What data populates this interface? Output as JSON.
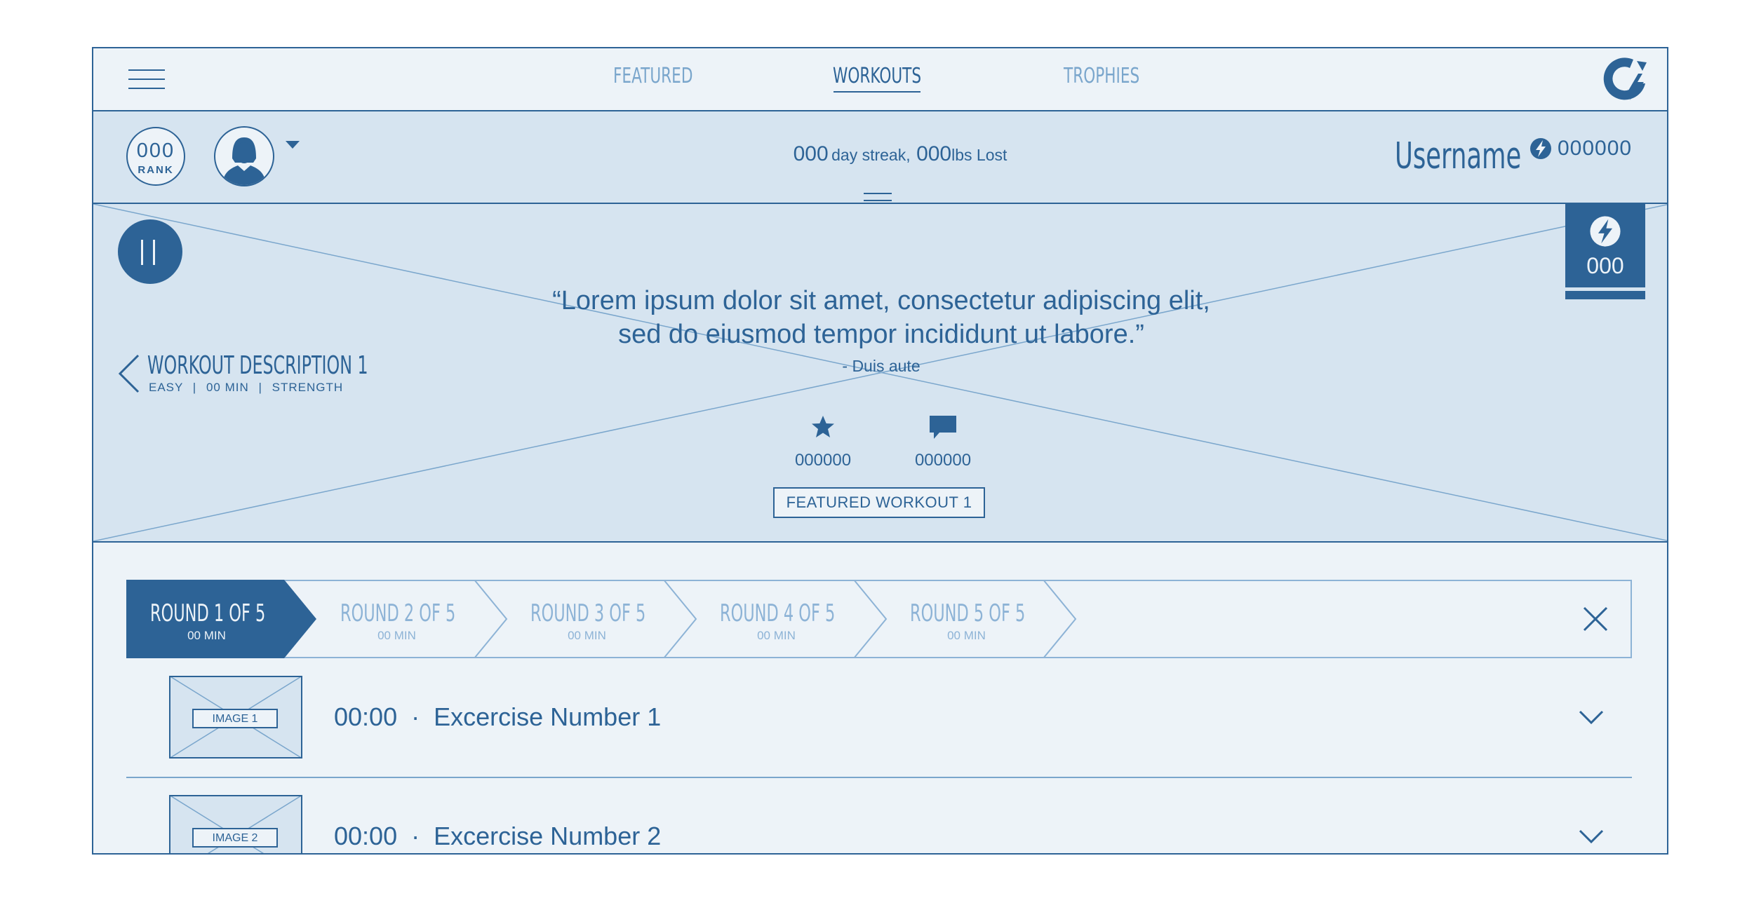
{
  "nav": {
    "tabs": [
      {
        "label": "FEATURED",
        "active": false
      },
      {
        "label": "WORKOUTS",
        "active": true
      },
      {
        "label": "TROPHIES",
        "active": false
      }
    ]
  },
  "profile": {
    "rank_value": "000",
    "rank_label": "RANK",
    "streak_count": "000",
    "streak_text": "day streak,",
    "lbs_count": "000",
    "lbs_text": "lbs Lost",
    "username": "Username",
    "points": "000000"
  },
  "hero": {
    "quote_line1": "“Lorem ipsum dolor sit amet, consectetur adipiscing elit,",
    "quote_line2": "sed do eiusmod tempor incididunt ut labore.”",
    "quote_author": "- Duis aute",
    "workout_title": "WORKOUT DESCRIPTION 1",
    "workout_meta": [
      "EASY",
      "00 MIN",
      "STRENGTH"
    ],
    "star_count": "000000",
    "comment_count": "000000",
    "featured_label": "FEATURED WORKOUT 1",
    "energy_count": "000"
  },
  "rounds": [
    {
      "title": "ROUND 1 OF 5",
      "duration": "00 MIN",
      "active": true
    },
    {
      "title": "ROUND 2 OF 5",
      "duration": "00 MIN",
      "active": false
    },
    {
      "title": "ROUND 3 OF 5",
      "duration": "00 MIN",
      "active": false
    },
    {
      "title": "ROUND 4 OF 5",
      "duration": "00 MIN",
      "active": false
    },
    {
      "title": "ROUND 5 OF 5",
      "duration": "00 MIN",
      "active": false
    }
  ],
  "exercises": [
    {
      "image_label": "IMAGE 1",
      "time": "00:00",
      "separator": "·",
      "name": "Excercise Number 1"
    },
    {
      "image_label": "IMAGE 2",
      "time": "00:00",
      "separator": "·",
      "name": "Excercise Number 2"
    }
  ],
  "icons": {
    "menu": "hamburger-icon",
    "logo": "brand-logo-icon",
    "dropdown": "caret-down-icon",
    "bolt": "lightning-bolt-icon",
    "pause": "pause-icon",
    "back": "chevron-left-icon",
    "star": "star-icon",
    "comment": "comment-icon",
    "close": "close-icon",
    "expand": "chevron-down-icon"
  },
  "colors": {
    "primary": "#2d6396",
    "light": "#7aa6cc",
    "panel": "#d6e4f0",
    "background": "#edf3f8"
  }
}
